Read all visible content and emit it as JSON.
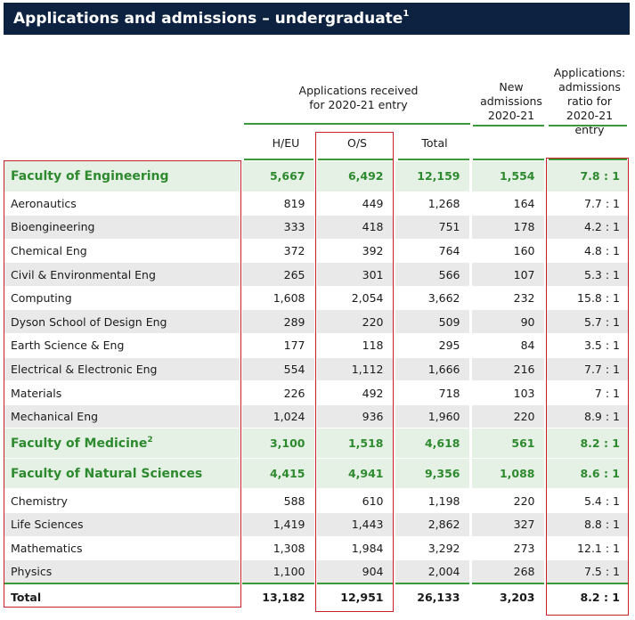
{
  "title": {
    "text": "Applications and admissions – undergraduate",
    "footnote": "1"
  },
  "headers": {
    "applications_group": "Applications received for 2020-21 entry",
    "col_heu": "H/EU",
    "col_os": "O/S",
    "col_total": "Total",
    "col_new_admissions": "New admissions 2020-21",
    "col_ratio": "Applications: admissions ratio for 2020-21 entry"
  },
  "rows": [
    {
      "type": "faculty",
      "name": "Faculty of Engineering",
      "sup": "",
      "heu": "5,667",
      "os": "6,492",
      "total": "12,159",
      "admissions": "1,554",
      "ratio": "7.8 : 1"
    },
    {
      "type": "plain",
      "name": "Aeronautics",
      "sup": "",
      "heu": "819",
      "os": "449",
      "total": "1,268",
      "admissions": "164",
      "ratio": "7.7 : 1"
    },
    {
      "type": "zebra",
      "name": "Bioengineering",
      "sup": "",
      "heu": "333",
      "os": "418",
      "total": "751",
      "admissions": "178",
      "ratio": "4.2 : 1"
    },
    {
      "type": "plain",
      "name": "Chemical Eng",
      "sup": "",
      "heu": "372",
      "os": "392",
      "total": "764",
      "admissions": "160",
      "ratio": "4.8 : 1"
    },
    {
      "type": "zebra",
      "name": "Civil & Environmental Eng",
      "sup": "",
      "heu": "265",
      "os": "301",
      "total": "566",
      "admissions": "107",
      "ratio": "5.3 : 1"
    },
    {
      "type": "plain",
      "name": "Computing",
      "sup": "",
      "heu": "1,608",
      "os": "2,054",
      "total": "3,662",
      "admissions": "232",
      "ratio": "15.8 : 1"
    },
    {
      "type": "zebra",
      "name": "Dyson School of Design Eng",
      "sup": "",
      "heu": "289",
      "os": "220",
      "total": "509",
      "admissions": "90",
      "ratio": "5.7 : 1"
    },
    {
      "type": "plain",
      "name": "Earth Science & Eng",
      "sup": "",
      "heu": "177",
      "os": "118",
      "total": "295",
      "admissions": "84",
      "ratio": "3.5 : 1"
    },
    {
      "type": "zebra",
      "name": "Electrical & Electronic Eng",
      "sup": "",
      "heu": "554",
      "os": "1,112",
      "total": "1,666",
      "admissions": "216",
      "ratio": "7.7 : 1"
    },
    {
      "type": "plain",
      "name": "Materials",
      "sup": "",
      "heu": "226",
      "os": "492",
      "total": "718",
      "admissions": "103",
      "ratio": "7 : 1"
    },
    {
      "type": "zebra",
      "name": "Mechanical Eng",
      "sup": "",
      "heu": "1,024",
      "os": "936",
      "total": "1,960",
      "admissions": "220",
      "ratio": "8.9 : 1"
    },
    {
      "type": "faculty",
      "name": "Faculty of Medicine",
      "sup": "2",
      "heu": "3,100",
      "os": "1,518",
      "total": "4,618",
      "admissions": "561",
      "ratio": "8.2 : 1"
    },
    {
      "type": "faculty",
      "name": "Faculty of Natural Sciences",
      "sup": "",
      "heu": "4,415",
      "os": "4,941",
      "total": "9,356",
      "admissions": "1,088",
      "ratio": "8.6 : 1"
    },
    {
      "type": "plain",
      "name": "Chemistry",
      "sup": "",
      "heu": "588",
      "os": "610",
      "total": "1,198",
      "admissions": "220",
      "ratio": "5.4 : 1"
    },
    {
      "type": "zebra",
      "name": "Life Sciences",
      "sup": "",
      "heu": "1,419",
      "os": "1,443",
      "total": "2,862",
      "admissions": "327",
      "ratio": "8.8 : 1"
    },
    {
      "type": "plain",
      "name": "Mathematics",
      "sup": "",
      "heu": "1,308",
      "os": "1,984",
      "total": "3,292",
      "admissions": "273",
      "ratio": "12.1 : 1"
    },
    {
      "type": "zebra",
      "name": "Physics",
      "sup": "",
      "heu": "1,100",
      "os": "904",
      "total": "2,004",
      "admissions": "268",
      "ratio": "7.5 : 1"
    },
    {
      "type": "total",
      "name": "Total",
      "sup": "",
      "heu": "13,182",
      "os": "12,951",
      "total": "26,133",
      "admissions": "3,203",
      "ratio": "8.2 : 1"
    }
  ],
  "colors": {
    "title_bg": "#0d2240",
    "faculty_text": "#2e8a2e",
    "faculty_bg": "#e6f1e6",
    "zebra_bg": "#e9e9e9",
    "rule": "#3a9a3a",
    "highlight_box": "#c8202a"
  }
}
